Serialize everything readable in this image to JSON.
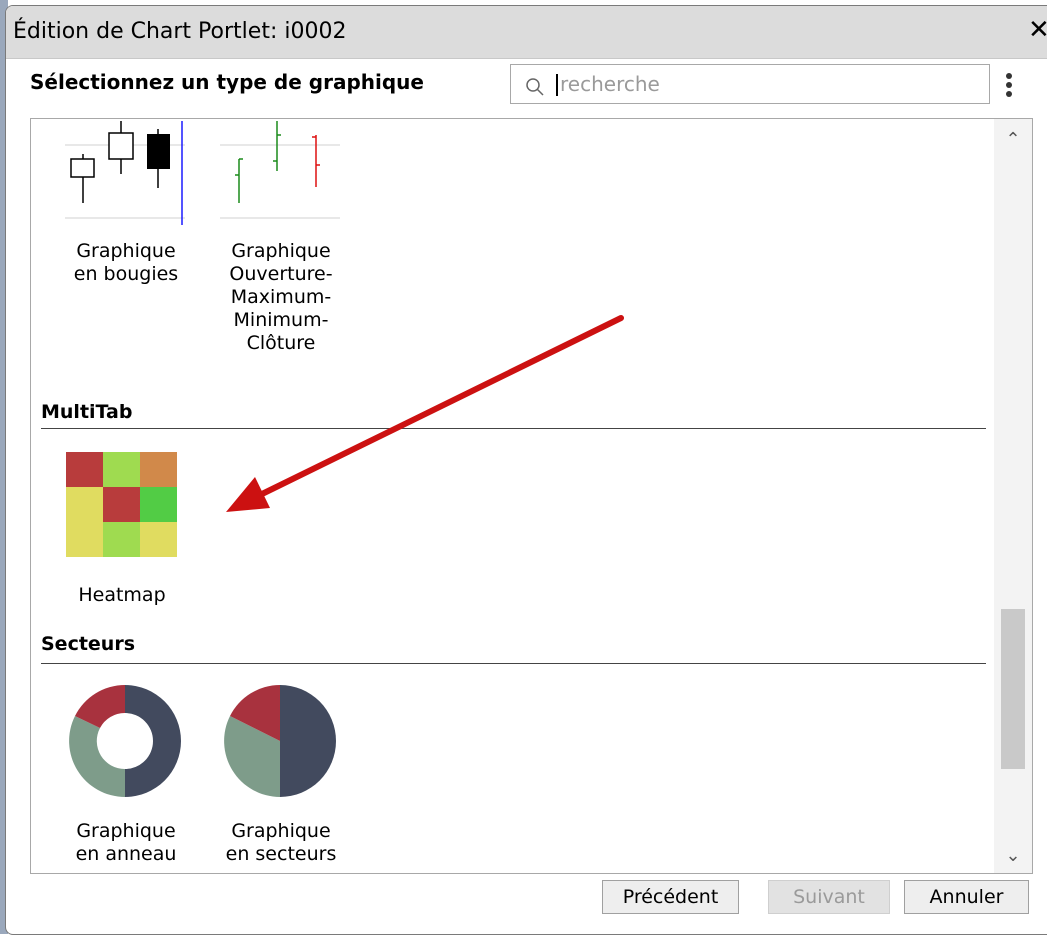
{
  "dialog": {
    "title": "Édition de Chart Portlet: i0002",
    "close_glyph": "✕"
  },
  "header": {
    "label": "Sélectionnez un type de graphique",
    "search_placeholder": "recherche",
    "search_value": ""
  },
  "sections": {
    "financial": {
      "items": [
        {
          "label_lines": [
            "Graphique",
            "en bougies"
          ],
          "icon": "candlestick-chart-icon"
        },
        {
          "label_lines": [
            "Graphique",
            "Ouverture-",
            "Maximum-",
            "Minimum-",
            "Clôture"
          ],
          "icon": "ohlc-chart-icon"
        }
      ]
    },
    "multitab": {
      "title": "MultiTab",
      "items": [
        {
          "label_lines": [
            "Heatmap"
          ],
          "icon": "heatmap-chart-icon"
        }
      ]
    },
    "secteurs": {
      "title": "Secteurs",
      "items": [
        {
          "label_lines": [
            "Graphique",
            "en anneau"
          ],
          "icon": "donut-chart-icon"
        },
        {
          "label_lines": [
            "Graphique",
            "en secteurs"
          ],
          "icon": "pie-chart-icon"
        }
      ]
    }
  },
  "footer": {
    "previous_label": "Précédent",
    "next_label": "Suivant",
    "cancel_label": "Annuler"
  },
  "colors": {
    "title_bar": "#dcdcdc",
    "annotation_arrow": "#cc1111",
    "heatmap_cells": [
      "#b83c3c",
      "#9fdb50",
      "#d1894a",
      "#e0dc60",
      "#b83c3c",
      "#52cc45",
      "#e0dc60",
      "#9fdb50",
      "#e0dc60"
    ],
    "pie_dark": "#424a5e",
    "pie_green": "#7e9c8a",
    "pie_red": "#a8323e"
  }
}
